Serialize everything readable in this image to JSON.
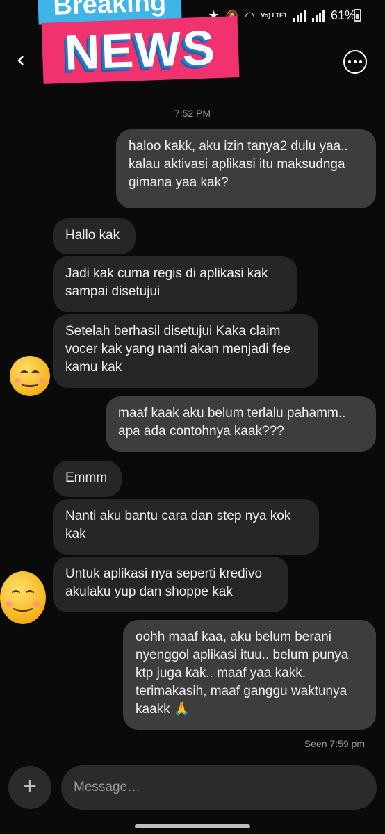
{
  "status_bar": {
    "battery": "61%",
    "network": "Vo) LTE1"
  },
  "sticker": {
    "top_word": "Breaking",
    "main_word": "NEWS"
  },
  "thread": {
    "timestamp": "7:52 PM",
    "messages": [
      {
        "from": "me",
        "text": "haloo kakk, aku izin tanya2 dulu yaa..\nkalau aktivasi aplikasi itu maksudnga\ngimana yaa kak?"
      },
      {
        "from": "them",
        "text": "Hallo kak"
      },
      {
        "from": "them",
        "text": "Jadi kak cuma regis di aplikasi kak\nsampai disetujui"
      },
      {
        "from": "them",
        "text": "Setelah berhasil disetujui Kaka claim\nvocer kak yang nanti akan menjadi fee\nkamu kak"
      },
      {
        "from": "me",
        "text": "maaf kaak aku belum terlalu pahamm..\napa ada contohnya kaak???"
      },
      {
        "from": "them",
        "text": "Emmm"
      },
      {
        "from": "them",
        "text": "Nanti aku bantu cara dan step nya kok\nkak"
      },
      {
        "from": "them",
        "text": "Untuk aplikasi nya seperti kredivo\nakulaku yup dan shoppe kak"
      },
      {
        "from": "me",
        "text": "oohh maaf kaa, aku belum berani\nnyenggol aplikasi ituu.. belum punya\nktp juga kak.. maaf yaa kakk.\nterimakasih, maaf ganggu waktunya\nkaakk 🙏"
      }
    ],
    "seen": "Seen 7:59 pm"
  },
  "composer": {
    "placeholder": "Message…"
  },
  "icons": {
    "back": "back-arrow-icon",
    "more": "more-options-icon",
    "add": "plus-icon",
    "avatar": "smiling-face-icon"
  }
}
